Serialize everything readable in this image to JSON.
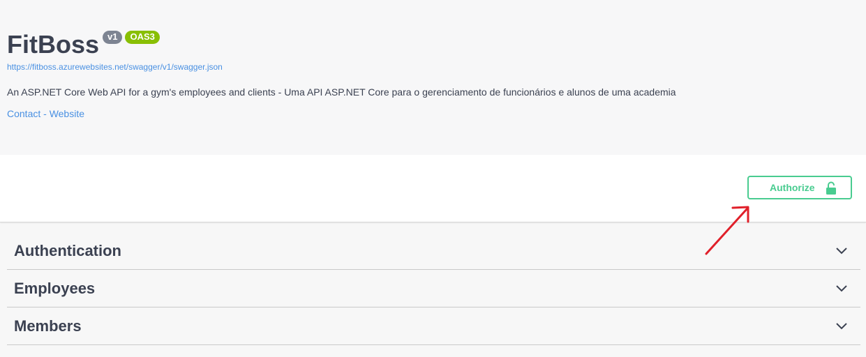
{
  "info": {
    "title": "FitBoss",
    "version_badge": "v1",
    "oas_badge": "OAS3",
    "spec_url": "https://fitboss.azurewebsites.net/swagger/v1/swagger.json",
    "description": "An ASP.NET Core Web API for a gym's employees and clients - Uma API ASP.NET Core para o gerenciamento de funcionários e alunos de uma academia",
    "contact_label": "Contact - Website"
  },
  "scheme": {
    "authorize_label": "Authorize"
  },
  "tags": [
    {
      "name": "Authentication"
    },
    {
      "name": "Employees"
    },
    {
      "name": "Members"
    }
  ],
  "colors": {
    "accent_green": "#49cc90",
    "link_blue": "#4990e2",
    "badge_gray": "#7d8492",
    "badge_green": "#89bf04",
    "annotation_red": "#e0202a"
  },
  "icons": {
    "authorize": "unlocked-lock-icon",
    "tag_toggle": "chevron-down-icon",
    "annotation": "red-arrow-icon"
  }
}
